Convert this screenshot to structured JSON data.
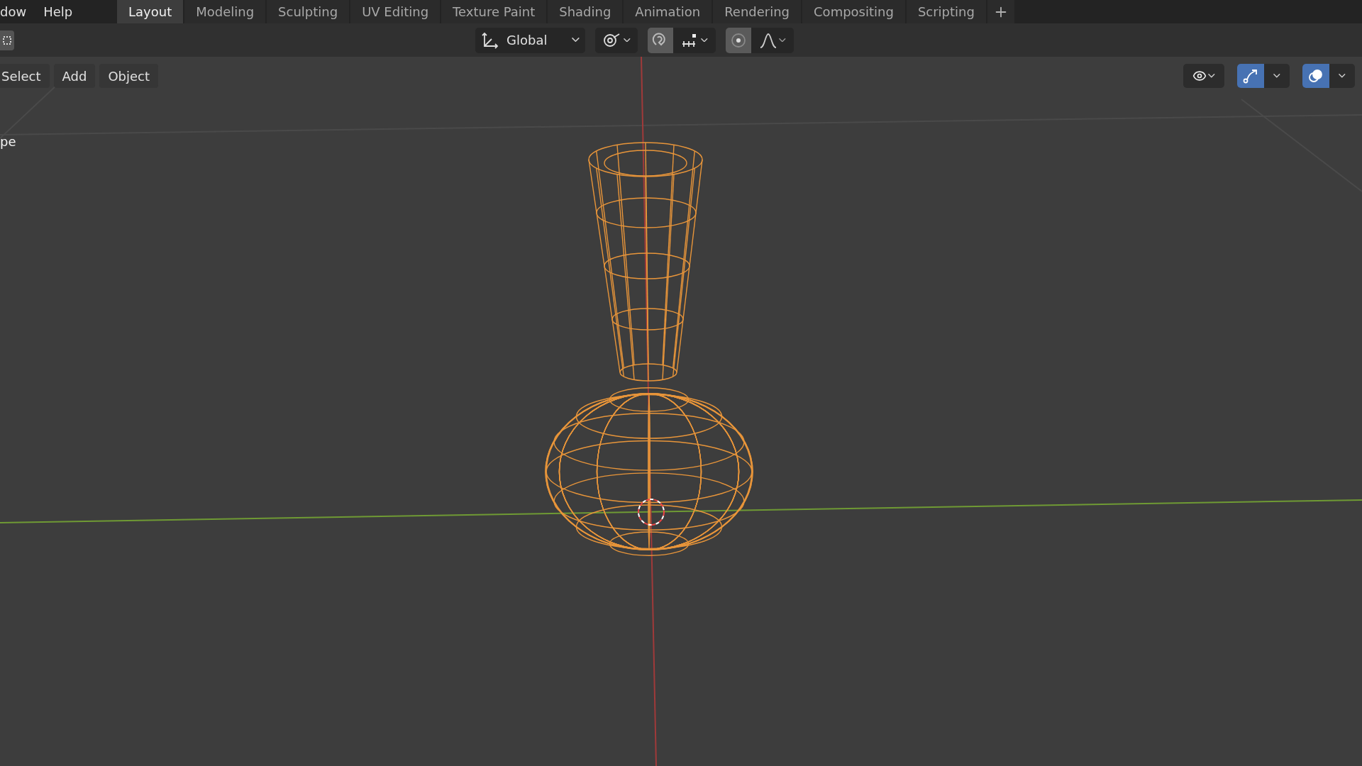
{
  "menu": [
    {
      "label": "dow"
    },
    {
      "label": "Help"
    }
  ],
  "workspace_tabs": [
    {
      "label": "Layout",
      "selected": true
    },
    {
      "label": "Modeling",
      "selected": false
    },
    {
      "label": "Sculpting",
      "selected": false
    },
    {
      "label": "UV Editing",
      "selected": false
    },
    {
      "label": "Texture Paint",
      "selected": false
    },
    {
      "label": "Shading",
      "selected": false
    },
    {
      "label": "Animation",
      "selected": false
    },
    {
      "label": "Rendering",
      "selected": false
    },
    {
      "label": "Compositing",
      "selected": false
    },
    {
      "label": "Scripting",
      "selected": false
    }
  ],
  "header": {
    "orientation": "Global",
    "snap": {
      "on": true
    },
    "proportional_editing": {
      "on": true
    }
  },
  "viewport": {
    "menus": [
      "Select",
      "Add",
      "Object"
    ],
    "object_label": "pe",
    "gizmos": {
      "on": true
    },
    "overlays": {
      "on": true
    }
  }
}
